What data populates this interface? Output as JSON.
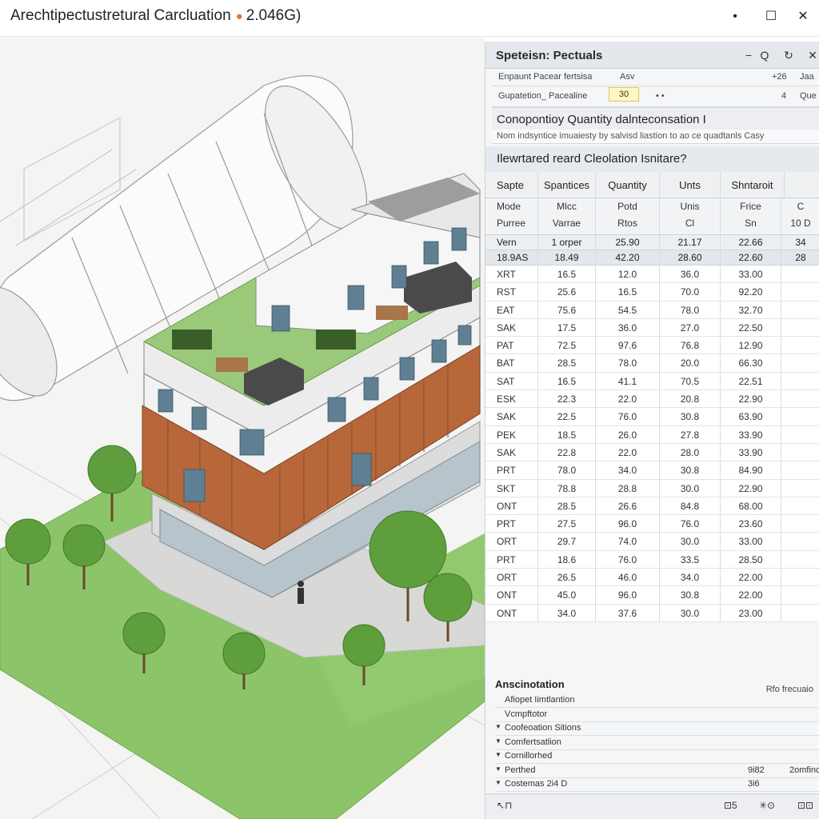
{
  "window": {
    "title": "Arechtipectustretural Carcluation",
    "title_version": "2.046G)",
    "controls": {
      "minimize": "•",
      "maximize": "☐",
      "close": "✕"
    }
  },
  "panel": {
    "title": "Speteisn: Pectuals",
    "header_buttons": {
      "minimize": "−",
      "search": "Q",
      "refresh": "↻",
      "close": "✕"
    },
    "props": [
      {
        "label": "Enpaunt Pacear fertsisa",
        "value": "Asv",
        "extra": "+26",
        "extra2": "Jaa"
      },
      {
        "label": "Gupatetion_ Pacealine",
        "value": "30",
        "extra_mid": "• •",
        "extra": "4",
        "extra2": "Que"
      }
    ],
    "section1": {
      "title": "Conopontioy Quantity dalnteconsation I",
      "subtitle": "Nom indsyntice imuaiesty by salvisd liastion to ao ce quadtanls Casy"
    },
    "section2": {
      "title": "Ilewrtared reard Cleolation Isnitare?"
    },
    "table": {
      "headers": [
        "Sapte",
        "Spantices",
        "Quantity",
        "Unts",
        "Shntaroit",
        ""
      ],
      "subheaders": [
        [
          "Mode",
          "Purree"
        ],
        [
          "Mlcc",
          "Varrae"
        ],
        [
          "Potd",
          "Rtos"
        ],
        [
          "Unis",
          "Cl"
        ],
        [
          "Frice",
          "Sn"
        ],
        [
          "C",
          "10 D"
        ]
      ],
      "summary_rows": [
        [
          "Vern",
          "1 orper",
          "25.90",
          "21.17",
          "22.66",
          "34"
        ],
        [
          "18.9AS",
          "18.49",
          "42.20",
          "28.60",
          "22.60",
          "28"
        ]
      ],
      "rows": [
        [
          "XRT",
          "16.5",
          "12.0",
          "36.0",
          "33.00"
        ],
        [
          "RST",
          "25.6",
          "16.5",
          "70.0",
          "92.20"
        ],
        [
          "EAT",
          "75.6",
          "54.5",
          "78.0",
          "32.70"
        ],
        [
          "SAK",
          "17.5",
          "36.0",
          "27.0",
          "22.50"
        ],
        [
          "PAT",
          "72.5",
          "97.6",
          "76.8",
          "12.90"
        ],
        [
          "BAT",
          "28.5",
          "78.0",
          "20.0",
          "66.30"
        ],
        [
          "SAT",
          "16.5",
          "41.1",
          "70.5",
          "22.51"
        ],
        [
          "ESK",
          "22.3",
          "22.0",
          "20.8",
          "22.90"
        ],
        [
          "SAK",
          "22.5",
          "76.0",
          "30.8",
          "63.90"
        ],
        [
          "PEK",
          "18.5",
          "26.0",
          "27.8",
          "33.90"
        ],
        [
          "SAK",
          "22.8",
          "22.0",
          "28.0",
          "33.90"
        ],
        [
          "PRT",
          "78.0",
          "34.0",
          "30.8",
          "84.90"
        ],
        [
          "SKT",
          "78.8",
          "28.8",
          "30.0",
          "22.90"
        ],
        [
          "ONT",
          "28.5",
          "26.6",
          "84.8",
          "68.00"
        ],
        [
          "PRT",
          "27.5",
          "96.0",
          "76.0",
          "23.60"
        ],
        [
          "ORT",
          "29.7",
          "74.0",
          "30.0",
          "33.00"
        ],
        [
          "PRT",
          "18.6",
          "76.0",
          "33.5",
          "28.50"
        ],
        [
          "ORT",
          "26.5",
          "46.0",
          "34.0",
          "22.00"
        ],
        [
          "ONT",
          "45.0",
          "96.0",
          "30.8",
          "22.00"
        ],
        [
          "ONT",
          "34.0",
          "37.6",
          "30.0",
          "23.00"
        ]
      ],
      "footer": "Rfo frecuaio"
    },
    "annotation": {
      "title": "Anscinotation",
      "items": [
        {
          "label": "Afiopet Iimtlantion",
          "expand": false
        },
        {
          "label": "Vcmpftotor",
          "expand": false
        },
        {
          "label": "Coofeoation Sitions",
          "expand": true
        },
        {
          "label": "Comfertsatlion",
          "expand": true
        },
        {
          "label": "Cornillorhed",
          "expand": true
        },
        {
          "label": "Perthed",
          "expand": true,
          "v1": "9i82",
          "v2": "2omfinc"
        },
        {
          "label": "Costemas 2i4 D",
          "expand": true,
          "v1": "3i6"
        }
      ]
    },
    "statusbar": {
      "left": "↖⊓",
      "mid1": "⊡5",
      "mid2": "✳⊙",
      "right": "⊡⊡"
    }
  },
  "colors": {
    "accent_pin": "#e07a3a",
    "wood": "#b8673a",
    "grass": "#8cc46a",
    "input_highlight": "#fff7c2"
  }
}
